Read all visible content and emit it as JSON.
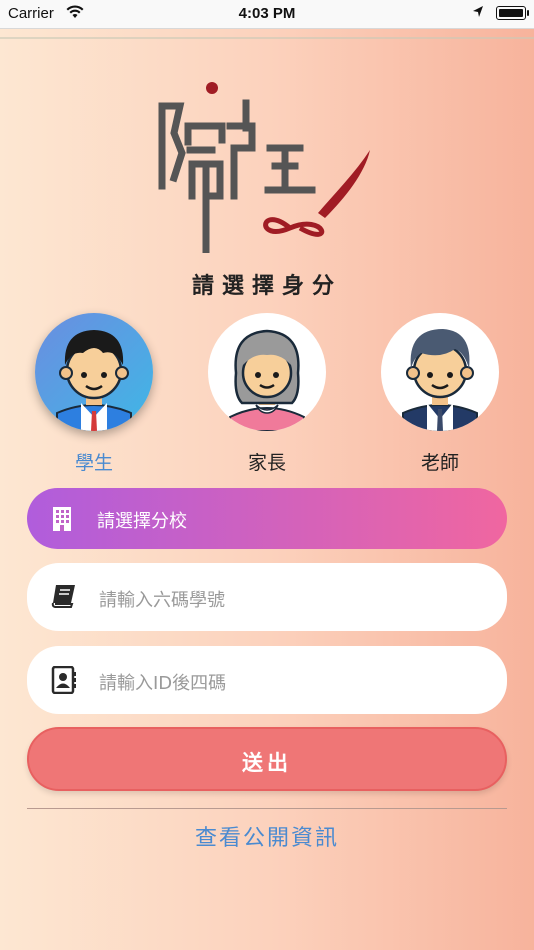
{
  "status_bar": {
    "carrier": "Carrier",
    "time": "4:03 PM",
    "battery_level": 1.0
  },
  "title": "請選擇身分",
  "roles": [
    {
      "label": "學生",
      "selected": true
    },
    {
      "label": "家長",
      "selected": false
    },
    {
      "label": "老師",
      "selected": false
    }
  ],
  "branch_select": {
    "label": "請選擇分校"
  },
  "student_id": {
    "placeholder": "請輸入六碼學號"
  },
  "id_last4": {
    "placeholder": "請輸入ID後四碼"
  },
  "submit_label": "送出",
  "public_info_link": "查看公開資訊",
  "colors": {
    "accent_blue": "#4a8ad0",
    "submit_red": "#ef7676",
    "logo_red": "#a01c24"
  }
}
